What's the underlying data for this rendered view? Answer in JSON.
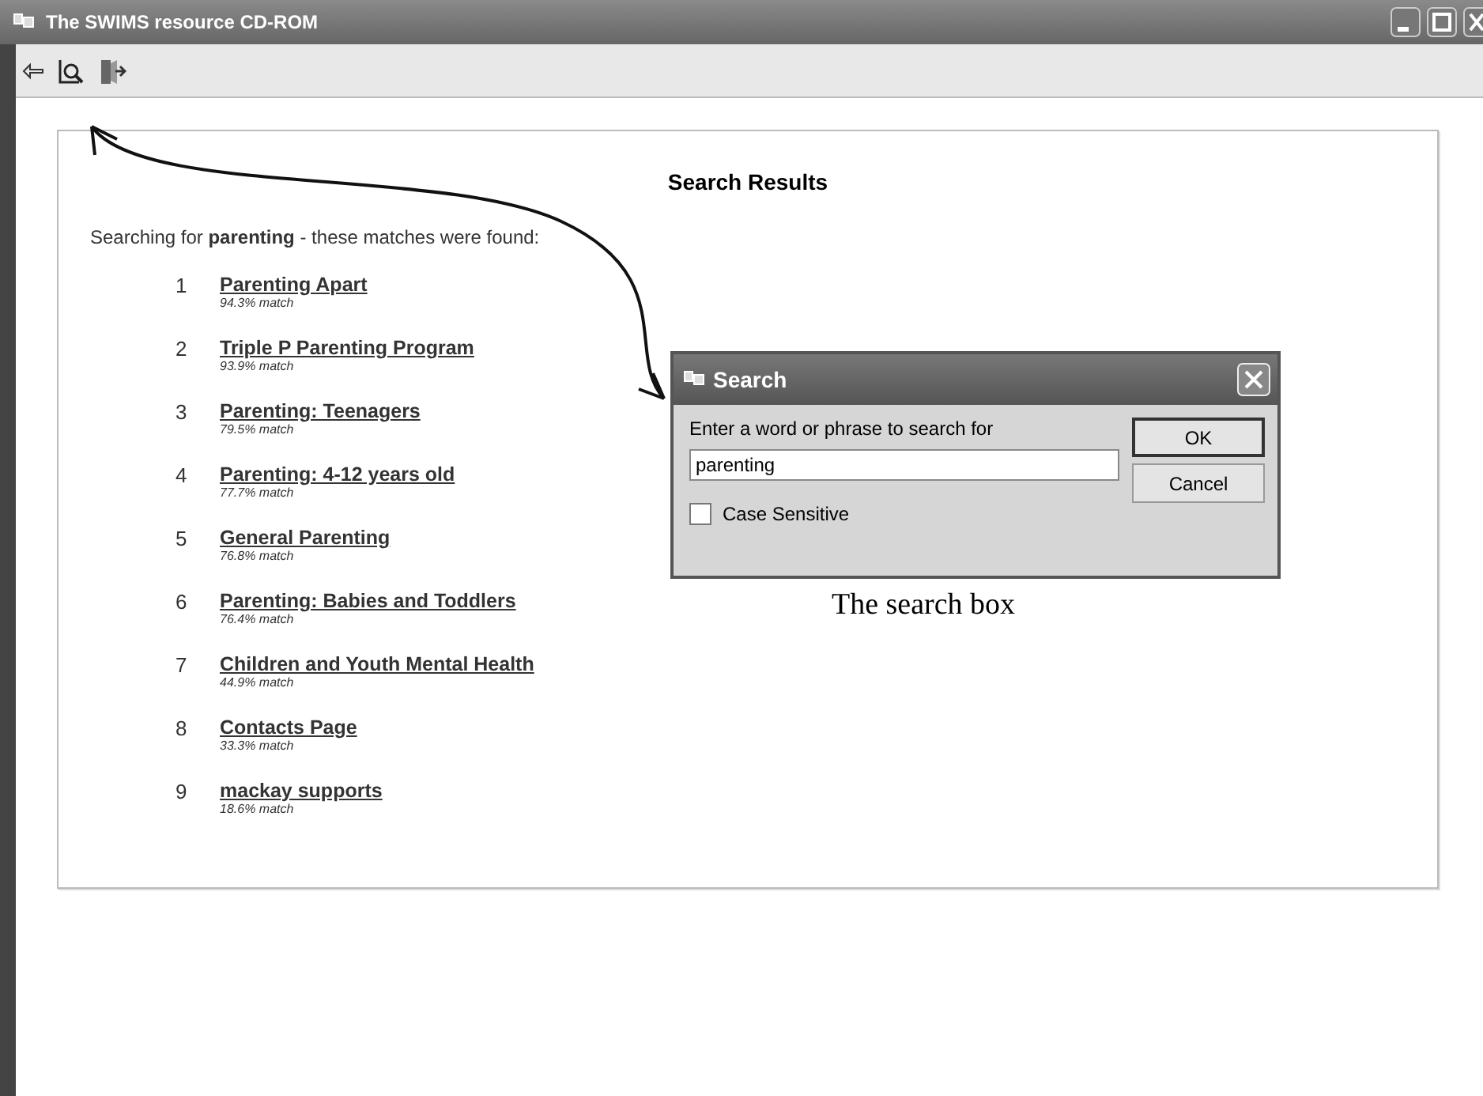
{
  "window": {
    "title": "The SWIMS resource CD-ROM"
  },
  "results": {
    "heading": "Search Results",
    "summary": "Searching for **parenting** - these matches were found:",
    "items": [
      {
        "number": "1",
        "title": "Parenting Apart",
        "match": "94.3% match"
      },
      {
        "number": "2",
        "title": "Triple P Parenting Program",
        "match": "93.9% match"
      },
      {
        "number": "3",
        "title": "Parenting: Teenagers",
        "match": "79.5% match"
      },
      {
        "number": "4",
        "title": "Parenting: 4-12 years old",
        "match": "77.7% match"
      },
      {
        "number": "5",
        "title": "General Parenting",
        "match": "76.8% match"
      },
      {
        "number": "6",
        "title": "Parenting: Babies and Toddlers",
        "match": "76.4% match"
      },
      {
        "number": "7",
        "title": "Children and Youth Mental Health",
        "match": "44.9% match"
      },
      {
        "number": "8",
        "title": "Contacts Page",
        "match": "33.3% match"
      },
      {
        "number": "9",
        "title": "mackay supports",
        "match": "18.6% match"
      }
    ]
  },
  "dialog": {
    "title": "Search",
    "prompt": "Enter a word or phrase to search for",
    "query": "parenting",
    "case_sensitive": {
      "label": "Case Sensitive",
      "checked": false
    },
    "buttons": [
      "OK",
      "Cancel"
    ]
  },
  "annotation": {
    "caption": "The search box"
  }
}
